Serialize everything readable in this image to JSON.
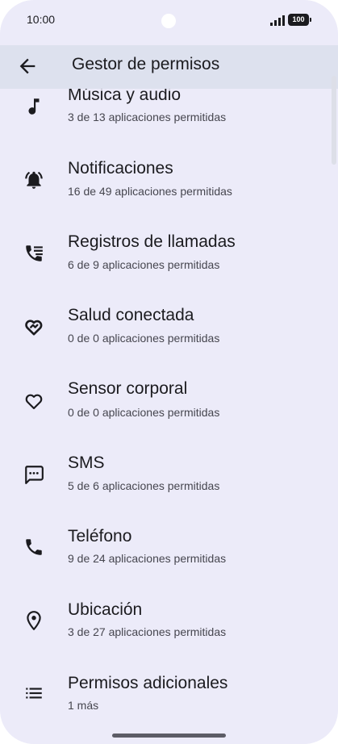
{
  "status_bar": {
    "time": "10:00",
    "battery": "100"
  },
  "app_bar": {
    "title": "Gestor de permisos"
  },
  "permissions": [
    {
      "label": "Música y audio",
      "sub": "3 de 13 aplicaciones permitidas",
      "icon": "music-note-icon"
    },
    {
      "label": "Notificaciones",
      "sub": "16 de 49 aplicaciones permitidas",
      "icon": "notification-bell-icon"
    },
    {
      "label": "Registros de llamadas",
      "sub": "6 de 9 aplicaciones permitidas",
      "icon": "call-log-icon"
    },
    {
      "label": "Salud conectada",
      "sub": "0 de 0 aplicaciones permitidas",
      "icon": "health-connect-icon"
    },
    {
      "label": "Sensor corporal",
      "sub": "0 de 0 aplicaciones permitidas",
      "icon": "heart-icon"
    },
    {
      "label": "SMS",
      "sub": "5 de 6 aplicaciones permitidas",
      "icon": "sms-icon"
    },
    {
      "label": "Teléfono",
      "sub": "9 de 24 aplicaciones permitidas",
      "icon": "phone-icon"
    },
    {
      "label": "Ubicación",
      "sub": "3 de 27 aplicaciones permitidas",
      "icon": "location-pin-icon"
    },
    {
      "label": "Permisos adicionales",
      "sub": "1 más",
      "icon": "list-icon"
    }
  ]
}
